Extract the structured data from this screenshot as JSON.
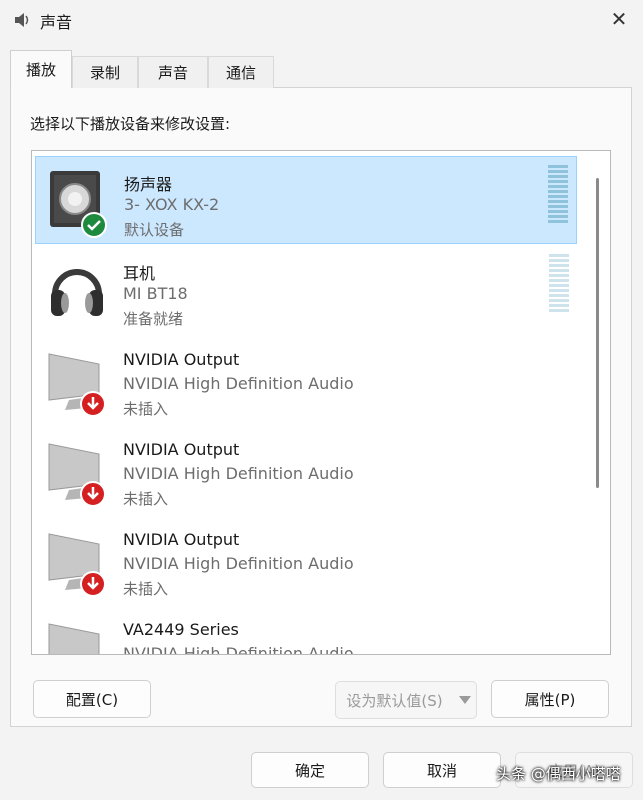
{
  "window": {
    "title": "声音",
    "close_glyph": "✕"
  },
  "tabs": [
    {
      "label": "播放",
      "active": true
    },
    {
      "label": "录制",
      "active": false
    },
    {
      "label": "声音",
      "active": false
    },
    {
      "label": "通信",
      "active": false
    }
  ],
  "instruction": "选择以下播放设备来修改设置:",
  "devices": [
    {
      "name": "扬声器",
      "description": "3- XOX KX-2",
      "status": "默认设备",
      "icon": "speaker-icon",
      "badge": "default-check-icon",
      "selected": true
    },
    {
      "name": "耳机",
      "description": "MI BT18",
      "status": "准备就绪",
      "icon": "headphones-icon",
      "selected": false
    },
    {
      "name": "NVIDIA Output",
      "description": "NVIDIA High Definition Audio",
      "status": "未插入",
      "icon": "monitor-icon",
      "badge": "unplugged-icon",
      "selected": false
    },
    {
      "name": "NVIDIA Output",
      "description": "NVIDIA High Definition Audio",
      "status": "未插入",
      "icon": "monitor-icon",
      "badge": "unplugged-icon",
      "selected": false
    },
    {
      "name": "NVIDIA Output",
      "description": "NVIDIA High Definition Audio",
      "status": "未插入",
      "icon": "monitor-icon",
      "badge": "unplugged-icon",
      "selected": false
    },
    {
      "name": "VA2449 Series",
      "description": "NVIDIA High Definition Audio",
      "status": "",
      "icon": "monitor-icon",
      "selected": false
    }
  ],
  "buttons": {
    "configure": "配置(C)",
    "set_default": "设为默认值(S)",
    "properties": "属性(P)",
    "ok": "确定",
    "cancel": "取消",
    "apply": "应用(A)"
  },
  "watermark": "头条 @偶西小嗒嗒",
  "colors": {
    "selection": "#cce8ff",
    "check_green": "#1e8a3e",
    "unplugged_red": "#d42020"
  }
}
